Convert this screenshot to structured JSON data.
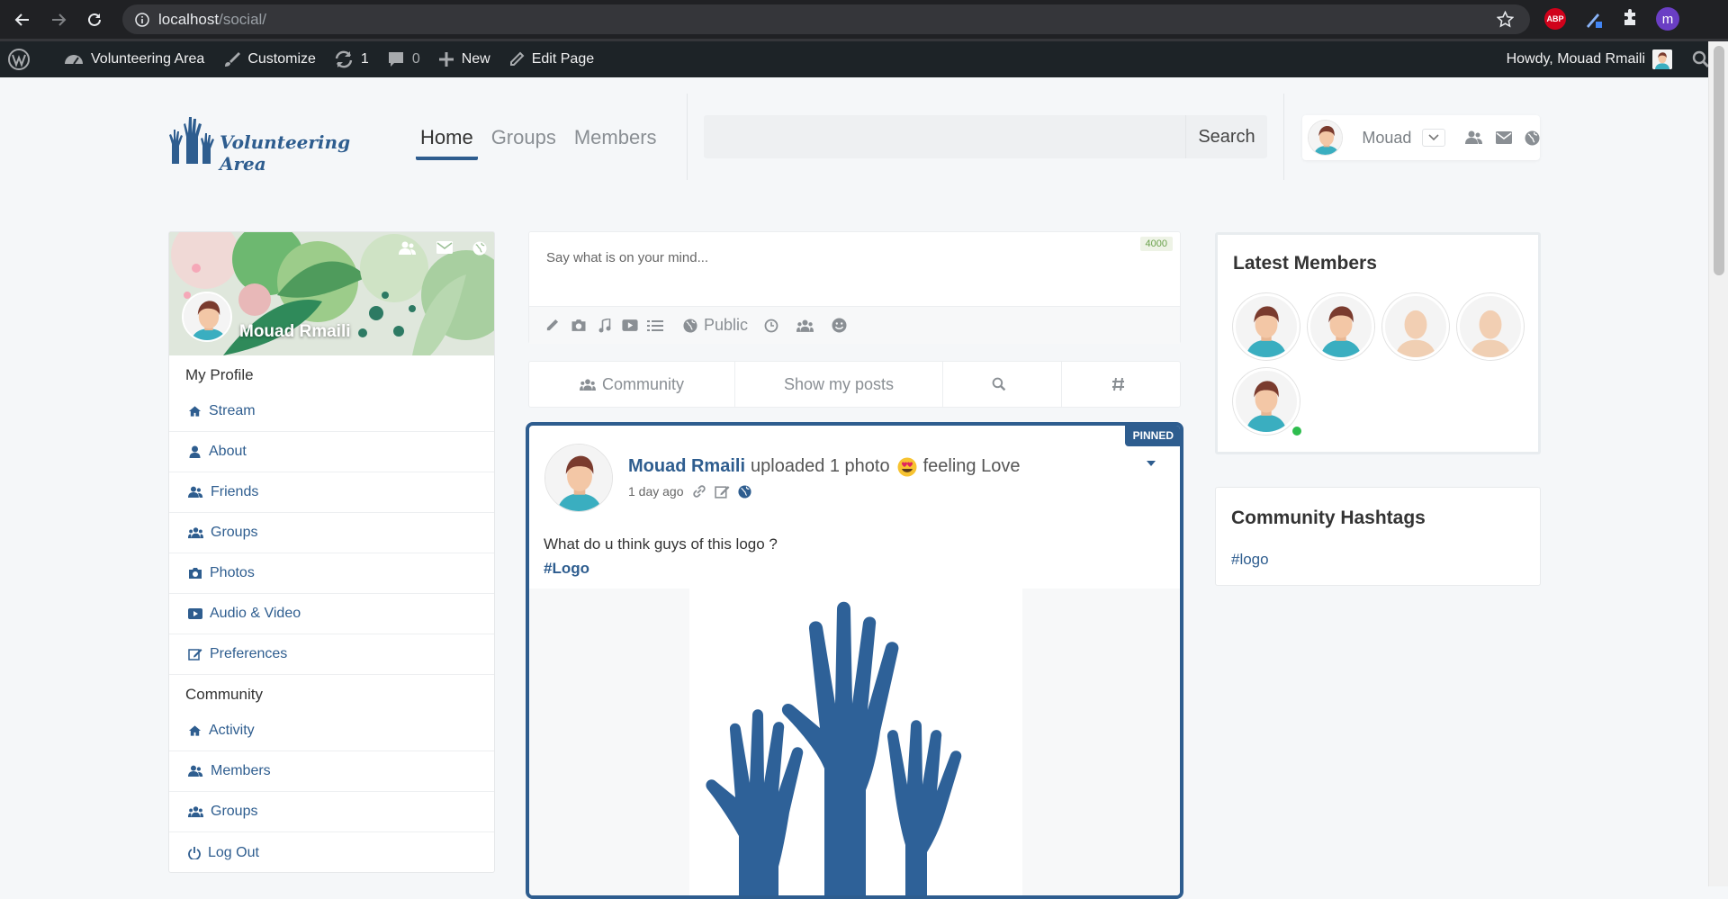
{
  "browser": {
    "url_host": "localhost",
    "url_path": "/social/",
    "abp_label": "ABP",
    "profile_initial": "m"
  },
  "admin_bar": {
    "site_name": "Volunteering Area",
    "customize": "Customize",
    "updates_count": "1",
    "comments_count": "0",
    "new_label": "New",
    "edit_page": "Edit Page",
    "howdy": "Howdy, Mouad Rmaili"
  },
  "header": {
    "logo_text": "Volunteering Area",
    "nav": [
      "Home",
      "Groups",
      "Members"
    ],
    "active_nav": "Home",
    "search_button": "Search",
    "search_placeholder": "",
    "user_name": "Mouad"
  },
  "profile": {
    "name": "Mouad Rmaili",
    "sections": [
      {
        "title": "My Profile",
        "items": [
          {
            "label": "Stream",
            "icon": "home-icon"
          },
          {
            "label": "About",
            "icon": "user-icon"
          },
          {
            "label": "Friends",
            "icon": "friends-icon"
          },
          {
            "label": "Groups",
            "icon": "groups-icon"
          },
          {
            "label": "Photos",
            "icon": "camera-icon"
          },
          {
            "label": "Audio & Video",
            "icon": "video-icon"
          },
          {
            "label": "Preferences",
            "icon": "edit-icon"
          }
        ]
      },
      {
        "title": "Community",
        "items": [
          {
            "label": "Activity",
            "icon": "home-icon"
          },
          {
            "label": "Members",
            "icon": "friends-icon"
          },
          {
            "label": "Groups",
            "icon": "groups-icon"
          },
          {
            "label": "Log Out",
            "icon": "power-icon"
          }
        ]
      }
    ]
  },
  "composer": {
    "placeholder": "Say what is on your mind...",
    "char_limit": "4000",
    "privacy": "Public"
  },
  "filters": {
    "community": "Community",
    "my_posts": "Show my posts"
  },
  "post": {
    "pinned_label": "PINNED",
    "author": "Mouad Rmaili",
    "action": "uploaded 1 photo",
    "feeling": "feeling Love",
    "time": "1 day ago",
    "text": "What do u think guys of this logo ?",
    "hashtag": "#Logo"
  },
  "sidebar": {
    "latest_members_title": "Latest Members",
    "hashtags_title": "Community Hashtags",
    "hashtags": [
      "#logo"
    ]
  },
  "colors": {
    "brand": "#2e5d8f",
    "online": "#2ebd4e",
    "adminbar": "#1d2327"
  }
}
